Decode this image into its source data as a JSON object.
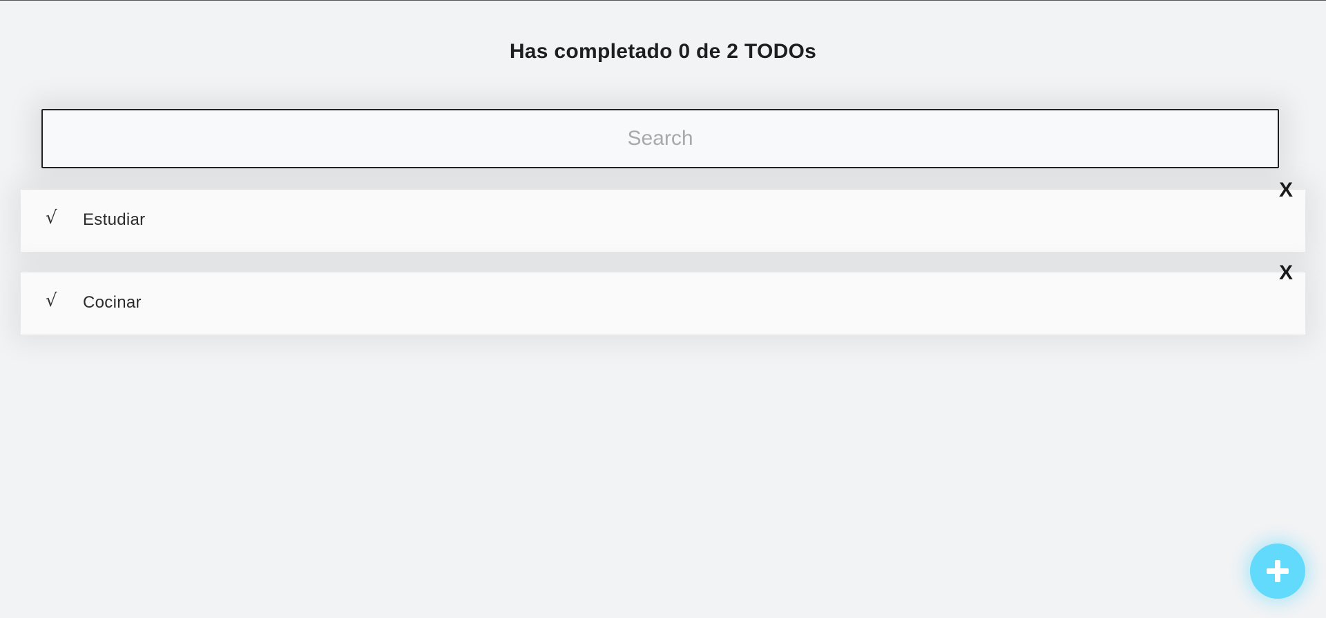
{
  "counter": {
    "text": "Has completado 0 de 2 TODOs"
  },
  "search": {
    "placeholder": "Search",
    "value": ""
  },
  "todos": [
    {
      "text": "Estudiar",
      "check_glyph": "√",
      "delete_glyph": "X",
      "completed": false
    },
    {
      "text": "Cocinar",
      "check_glyph": "√",
      "delete_glyph": "X",
      "completed": false
    }
  ],
  "add_button": {
    "icon": "plus-icon",
    "color": "#61dafb"
  },
  "colors": {
    "background": "#f2f3f5",
    "accent": "#61dafb",
    "text": "#1e1e1e"
  }
}
